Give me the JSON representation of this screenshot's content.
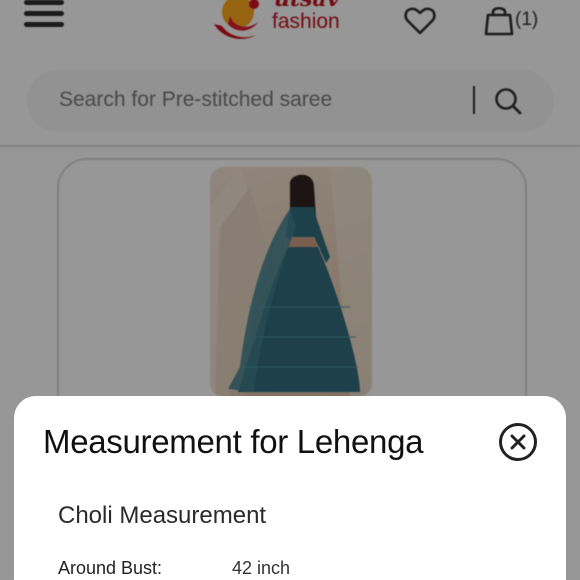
{
  "header": {
    "logo_top": "utsav",
    "logo_bottom": "fashion",
    "cart_count": "(1)"
  },
  "search": {
    "placeholder": "Search for Pre-stitched saree"
  },
  "modal": {
    "title": "Measurement for Lehenga",
    "section_title": "Choli Measurement",
    "rows": [
      {
        "label": "Around Bust:",
        "value": "42 inch"
      }
    ]
  },
  "colors": {
    "brand": "#b9121b",
    "overlay": "rgba(0,0,0,0.38)"
  },
  "icons": {
    "menu": "hamburger-menu-icon",
    "wishlist": "heart-icon",
    "cart": "shopping-bag-icon",
    "search": "search-icon",
    "close": "close-circle-icon"
  }
}
